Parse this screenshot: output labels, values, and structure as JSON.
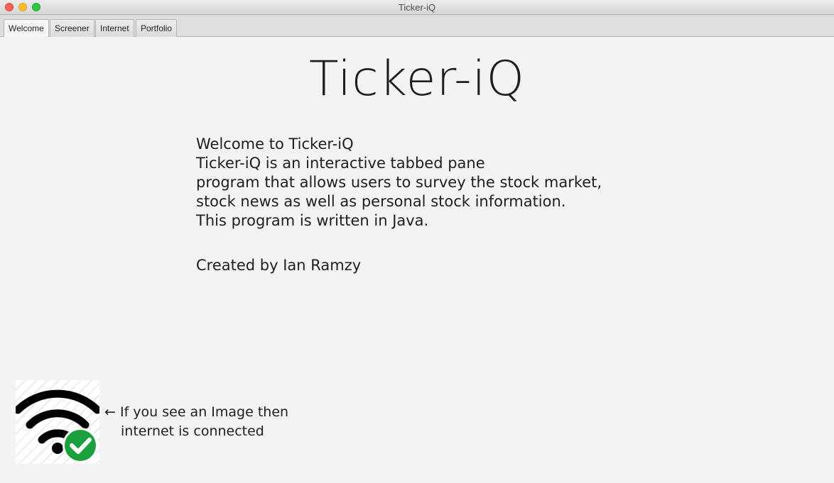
{
  "window": {
    "title": "Ticker-iQ"
  },
  "tabs": [
    {
      "label": "Welcome",
      "active": true
    },
    {
      "label": "Screener",
      "active": false
    },
    {
      "label": "Internet",
      "active": false
    },
    {
      "label": "Portfolio",
      "active": false
    }
  ],
  "welcome": {
    "heading": "Ticker-iQ",
    "description": [
      "Welcome to Ticker-iQ",
      "Ticker-iQ is an interactive tabbed pane",
      "program that allows users to survey the stock market,",
      "stock news as well as personal stock information.",
      "This program is written in Java."
    ],
    "credit": "Created by Ian Ramzy",
    "connection": {
      "icon": "wifi-connected-icon",
      "note_line1": "← If you see an Image then",
      "note_line2": "internet is connected",
      "check_color": "#1aa03c"
    }
  },
  "colors": {
    "close": "#fc5f57",
    "minimize": "#fdbc2e",
    "maximize": "#29c940",
    "background": "#f3f3f3"
  }
}
